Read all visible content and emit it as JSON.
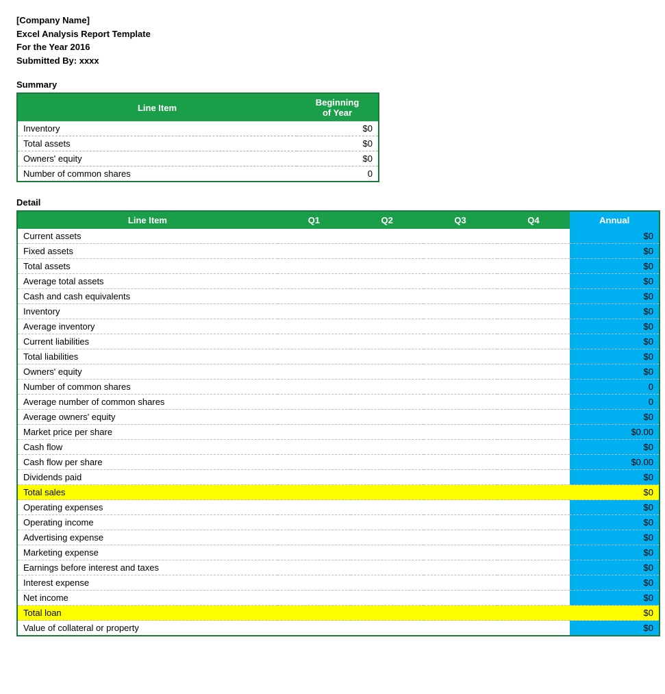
{
  "header": {
    "line1": "[Company Name]",
    "line2": "Excel Analysis Report Template",
    "line3": "For the Year 2016",
    "line4": "Submitted By:  xxxx"
  },
  "summary": {
    "section_label": "Summary",
    "col_line_item": "Line Item",
    "col_beginning": "Beginning\nof Year",
    "rows": [
      {
        "label": "Inventory",
        "value": "$0"
      },
      {
        "label": "Total assets",
        "value": "$0"
      },
      {
        "label": "Owners' equity",
        "value": "$0"
      },
      {
        "label": "Number of common shares",
        "value": "0"
      }
    ]
  },
  "detail": {
    "section_label": "Detail",
    "cols": {
      "line_item": "Line Item",
      "q1": "Q1",
      "q2": "Q2",
      "q3": "Q3",
      "q4": "Q4",
      "annual": "Annual"
    },
    "rows": [
      {
        "label": "Current assets",
        "q1": "",
        "q2": "",
        "q3": "",
        "q4": "",
        "annual": "$0",
        "type": "normal"
      },
      {
        "label": "Fixed assets",
        "q1": "",
        "q2": "",
        "q3": "",
        "q4": "",
        "annual": "$0",
        "type": "normal"
      },
      {
        "label": "Total assets",
        "q1": "",
        "q2": "",
        "q3": "",
        "q4": "",
        "annual": "$0",
        "type": "normal"
      },
      {
        "label": "Average total assets",
        "q1": "",
        "q2": "",
        "q3": "",
        "q4": "",
        "annual": "$0",
        "type": "normal"
      },
      {
        "label": "Cash and cash equivalents",
        "q1": "",
        "q2": "",
        "q3": "",
        "q4": "",
        "annual": "$0",
        "type": "normal"
      },
      {
        "label": "Inventory",
        "q1": "",
        "q2": "",
        "q3": "",
        "q4": "",
        "annual": "$0",
        "type": "normal"
      },
      {
        "label": "Average inventory",
        "q1": "",
        "q2": "",
        "q3": "",
        "q4": "",
        "annual": "$0",
        "type": "normal"
      },
      {
        "label": "Current liabilities",
        "q1": "",
        "q2": "",
        "q3": "",
        "q4": "",
        "annual": "$0",
        "type": "normal"
      },
      {
        "label": "Total liabilities",
        "q1": "",
        "q2": "",
        "q3": "",
        "q4": "",
        "annual": "$0",
        "type": "normal"
      },
      {
        "label": "Owners' equity",
        "q1": "",
        "q2": "",
        "q3": "",
        "q4": "",
        "annual": "$0",
        "type": "normal"
      },
      {
        "label": "Number of common shares",
        "q1": "",
        "q2": "",
        "q3": "",
        "q4": "",
        "annual": "0",
        "type": "normal"
      },
      {
        "label": "Average number of common shares",
        "q1": "",
        "q2": "",
        "q3": "",
        "q4": "",
        "annual": "0",
        "type": "normal"
      },
      {
        "label": "Average owners' equity",
        "q1": "",
        "q2": "",
        "q3": "",
        "q4": "",
        "annual": "$0",
        "type": "normal"
      },
      {
        "label": "Market price per share",
        "q1": "",
        "q2": "",
        "q3": "",
        "q4": "",
        "annual": "$0.00",
        "type": "normal"
      },
      {
        "label": "Cash flow",
        "q1": "",
        "q2": "",
        "q3": "",
        "q4": "",
        "annual": "$0",
        "type": "normal"
      },
      {
        "label": "Cash flow per share",
        "q1": "",
        "q2": "",
        "q3": "",
        "q4": "",
        "annual": "$0.00",
        "type": "normal"
      },
      {
        "label": "Dividends paid",
        "q1": "",
        "q2": "",
        "q3": "",
        "q4": "",
        "annual": "$0",
        "type": "normal"
      },
      {
        "label": "Total sales",
        "q1": "",
        "q2": "",
        "q3": "",
        "q4": "",
        "annual": "$0",
        "type": "total-sales"
      },
      {
        "label": "Operating expenses",
        "q1": "",
        "q2": "",
        "q3": "",
        "q4": "",
        "annual": "$0",
        "type": "normal"
      },
      {
        "label": "Operating income",
        "q1": "",
        "q2": "",
        "q3": "",
        "q4": "",
        "annual": "$0",
        "type": "normal"
      },
      {
        "label": "Advertising expense",
        "q1": "",
        "q2": "",
        "q3": "",
        "q4": "",
        "annual": "$0",
        "type": "normal"
      },
      {
        "label": "Marketing expense",
        "q1": "",
        "q2": "",
        "q3": "",
        "q4": "",
        "annual": "$0",
        "type": "normal"
      },
      {
        "label": "Earnings before interest and taxes",
        "q1": "",
        "q2": "",
        "q3": "",
        "q4": "",
        "annual": "$0",
        "type": "normal"
      },
      {
        "label": "Interest expense",
        "q1": "",
        "q2": "",
        "q3": "",
        "q4": "",
        "annual": "$0",
        "type": "normal"
      },
      {
        "label": "Net income",
        "q1": "",
        "q2": "",
        "q3": "",
        "q4": "",
        "annual": "$0",
        "type": "normal"
      },
      {
        "label": "Total loan",
        "q1": "",
        "q2": "",
        "q3": "",
        "q4": "",
        "annual": "$0",
        "type": "total-loan"
      },
      {
        "label": "Value of collateral or property",
        "q1": "",
        "q2": "",
        "q3": "",
        "q4": "",
        "annual": "$0",
        "type": "normal"
      }
    ]
  }
}
